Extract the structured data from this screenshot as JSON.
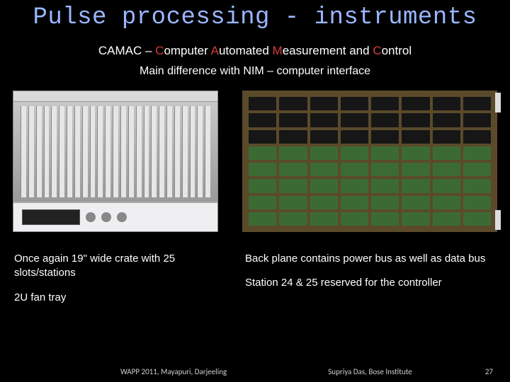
{
  "title": "Pulse processing - instruments",
  "subtitle": {
    "prefix": "CAMAC – ",
    "c": "C",
    "computer_rest": "omputer ",
    "a": "A",
    "automated_rest": "utomated ",
    "m": "M",
    "measurement_rest": "easurement and ",
    "c2": "C",
    "control_rest": "ontrol"
  },
  "subnote": "Main difference with NIM – computer interface",
  "left": {
    "crate": "Once again 19\" wide crate with 25 slots/stations",
    "fan": "2U fan tray"
  },
  "right": {
    "bus": "Back plane contains power bus as well as data bus",
    "controller": "Station 24 & 25 reserved for the controller"
  },
  "footer": {
    "event": "WAPP 2011, Mayapuri, Darjeeling",
    "author": "Supriya Das, Bose Institute",
    "page": "27"
  }
}
